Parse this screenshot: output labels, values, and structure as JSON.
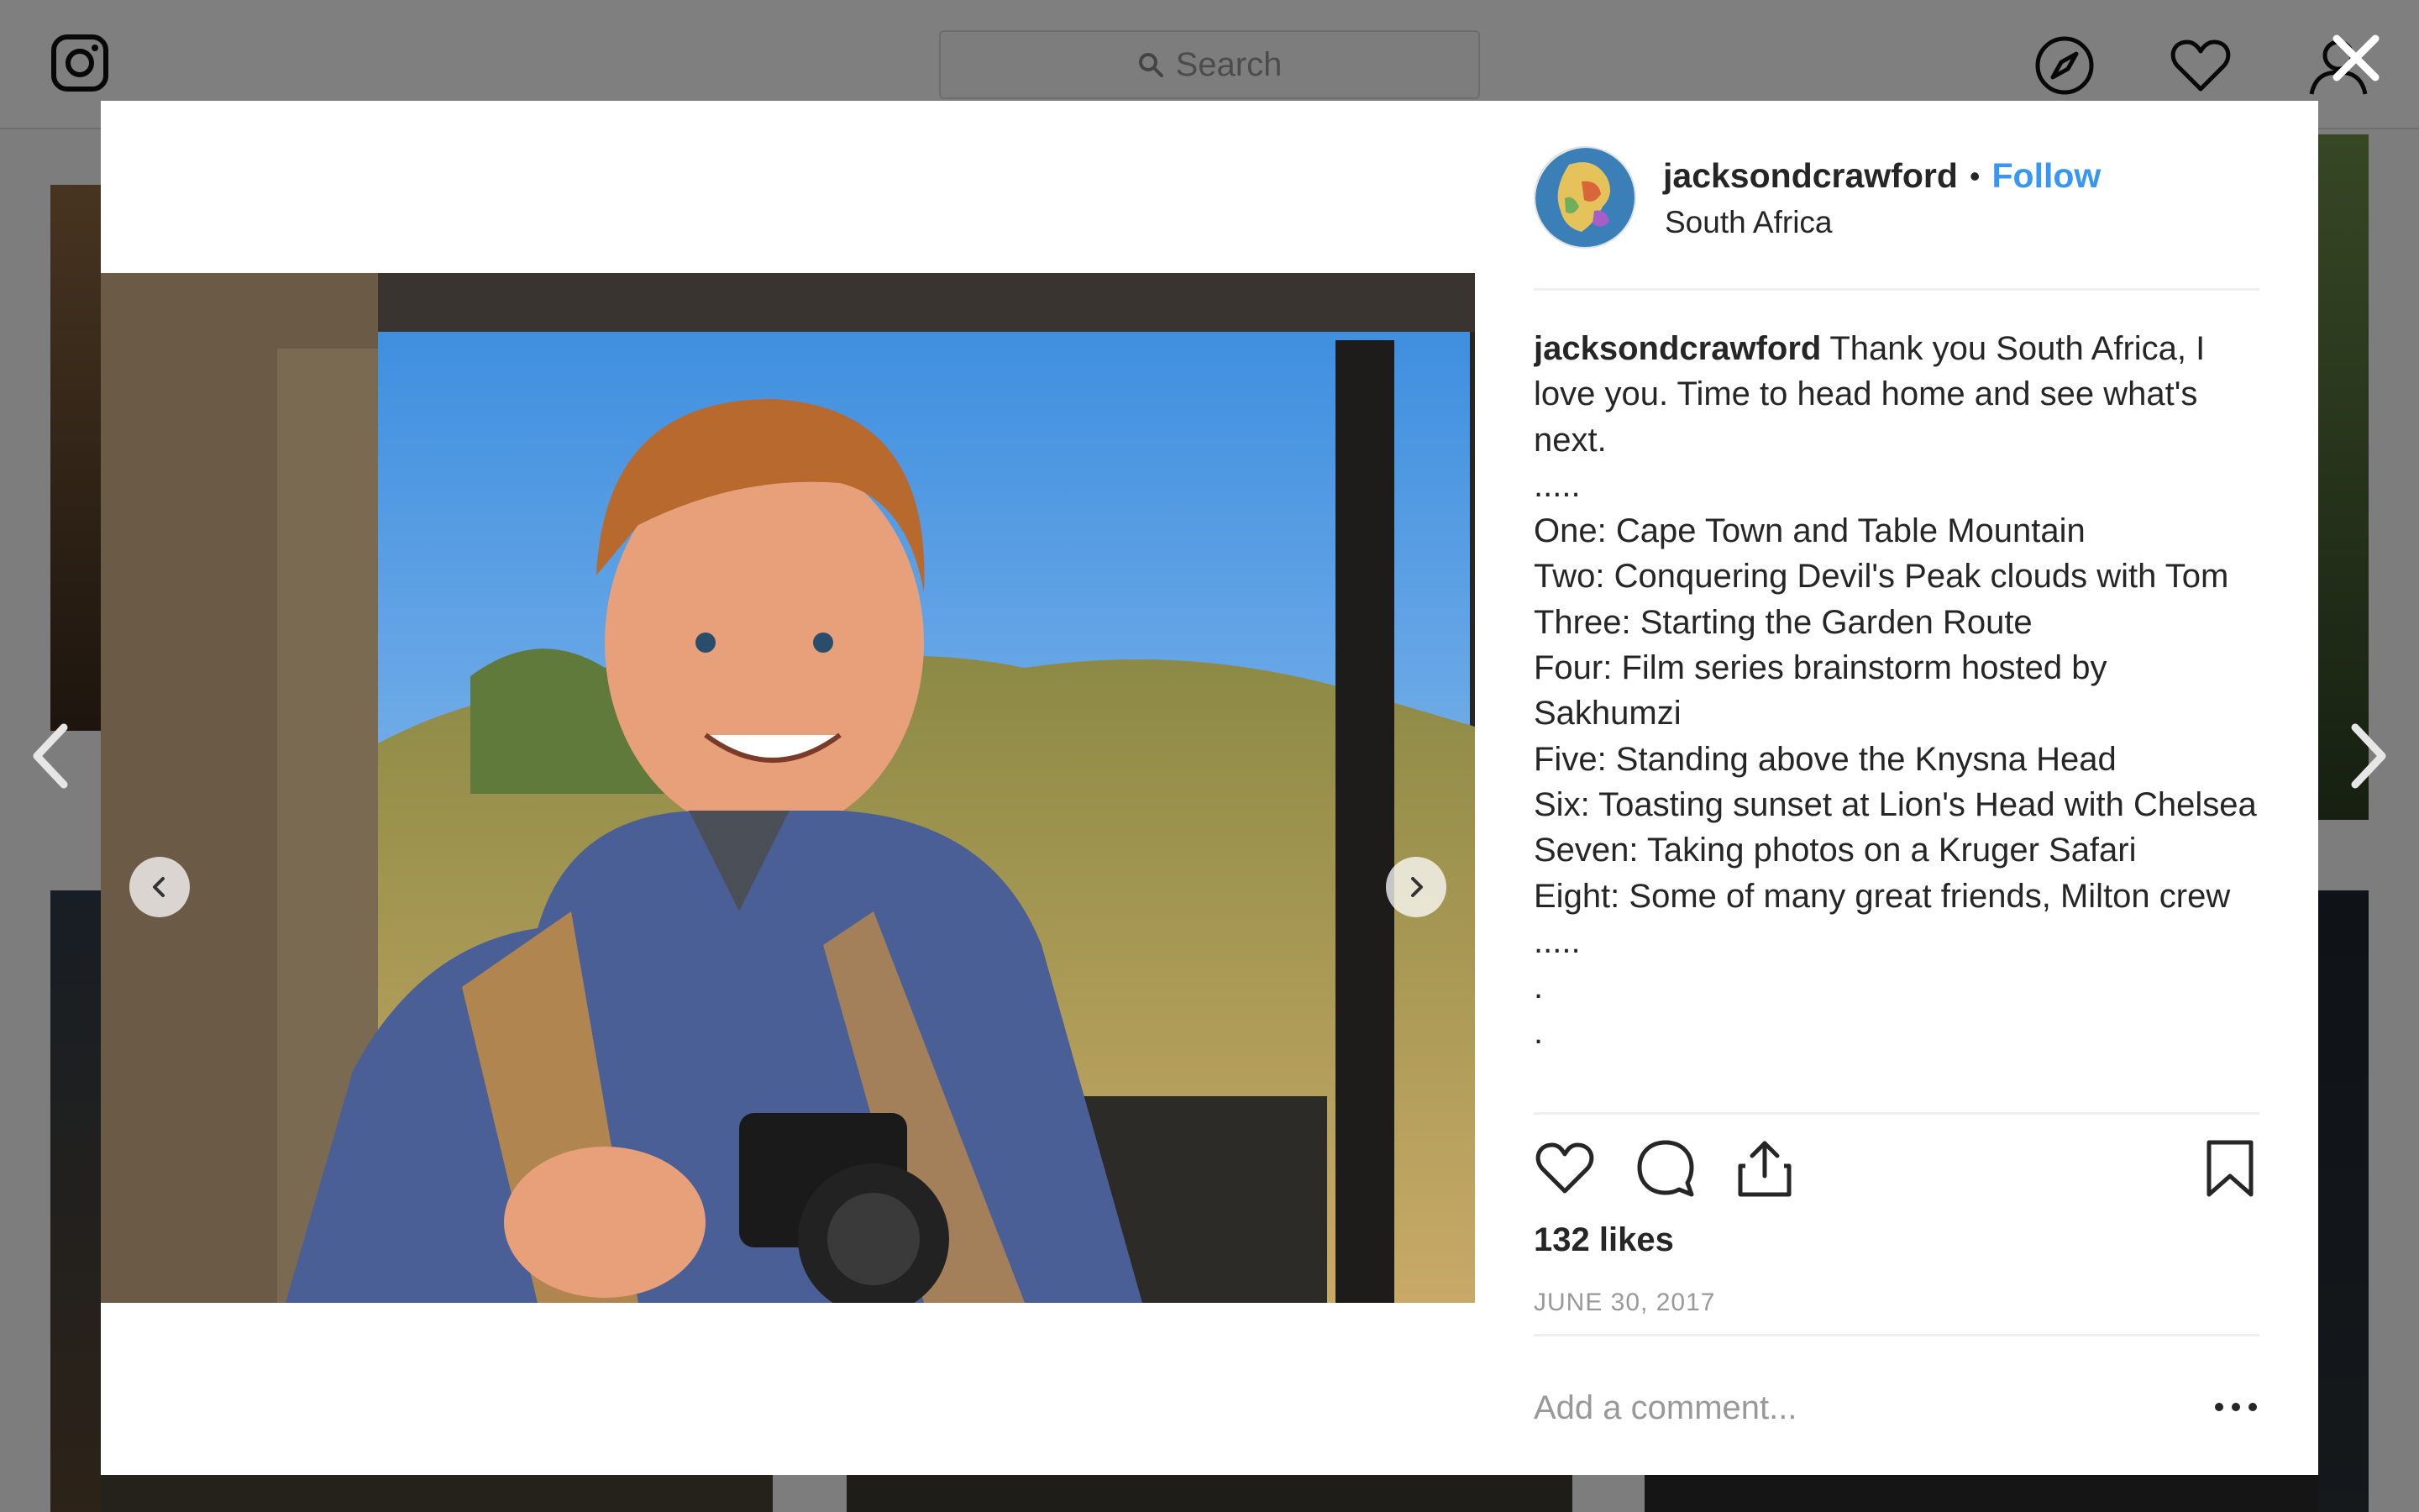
{
  "nav": {
    "search_placeholder": "Search"
  },
  "post": {
    "username": "jacksondcrawford",
    "follow_label": "Follow",
    "location": "South Africa",
    "caption_user": "jacksondcrawford",
    "caption_lines": [
      "Thank you South Africa, I love you. Time to head home and see what's next.",
      ".....",
      "One: Cape Town and Table Mountain",
      "Two: Conquering Devil's Peak clouds with Tom",
      "Three: Starting the Garden Route",
      "Four: Film series brainstorm hosted by Sakhumzi",
      "Five: Standing above the Knysna Head",
      "Six: Toasting sunset at Lion's Head with Chelsea",
      "Seven: Taking photos on a Kruger Safari",
      "Eight: Some of many great friends, Milton crew",
      ".....",
      ".",
      "."
    ],
    "likes": "132 likes",
    "date": "JUNE 30, 2017",
    "comment_placeholder": "Add a comment..."
  },
  "colors": {
    "link_blue": "#3897f0",
    "text_dark": "#262626",
    "text_muted": "#999999"
  },
  "icons": {
    "close": "close-icon",
    "prev": "chevron-left-icon",
    "next": "chevron-right-icon",
    "like": "heart-icon",
    "comment": "comment-icon",
    "share": "share-icon",
    "save": "bookmark-icon",
    "more": "more-icon"
  }
}
